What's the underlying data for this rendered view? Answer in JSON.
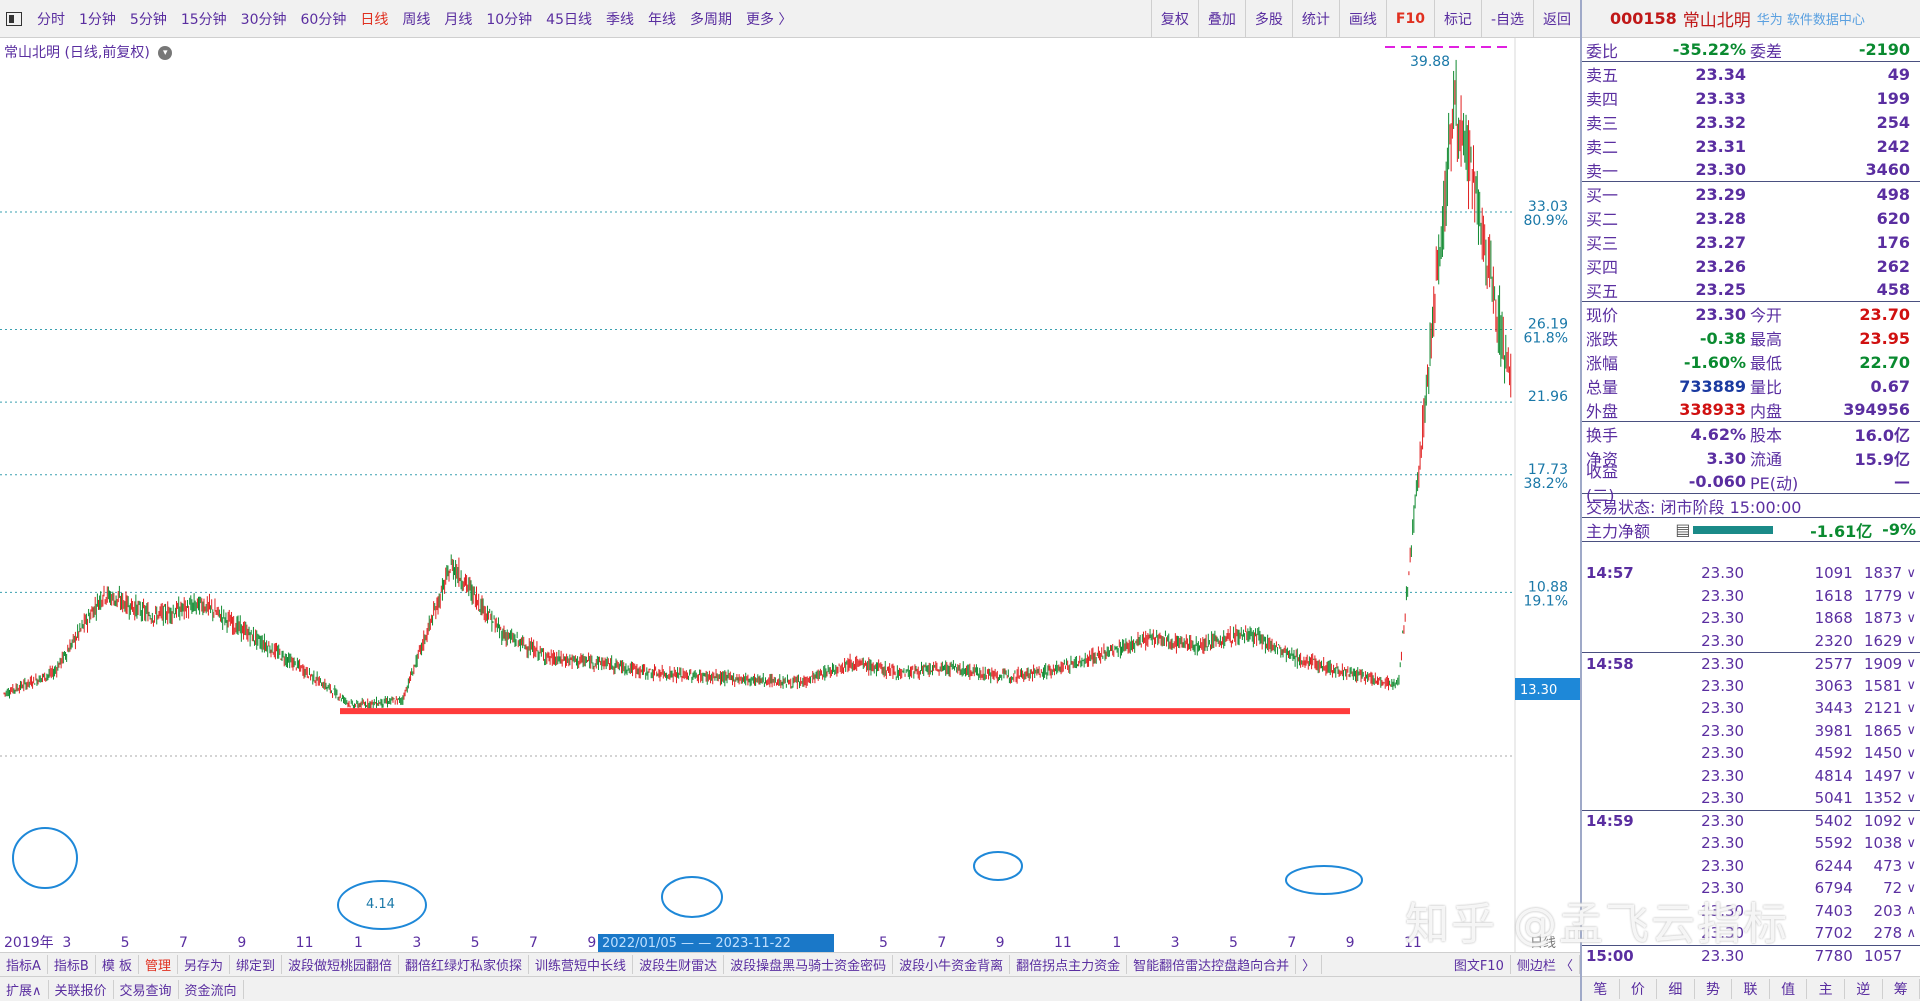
{
  "toolbar": {
    "periods": [
      "分时",
      "1分钟",
      "5分钟",
      "15分钟",
      "30分钟",
      "60分钟",
      "日线",
      "周线",
      "月线",
      "10分钟",
      "45日线",
      "季线",
      "年线",
      "多周期",
      "更多 〉"
    ],
    "tools": [
      "复权",
      "叠加",
      "多股",
      "统计",
      "画线",
      "F10",
      "标记",
      "-自选",
      "返回"
    ]
  },
  "chart": {
    "title": "常山北明 (日线,前复权)",
    "peak_label": "39.88",
    "low_label": "4.14",
    "current_price_label": "13.30",
    "axis_labels": [
      {
        "price": "33.03",
        "pct": "80.9%"
      },
      {
        "price": "26.19",
        "pct": "61.8%"
      },
      {
        "price": "21.96",
        "pct": ""
      },
      {
        "price": "17.73",
        "pct": "38.2%"
      },
      {
        "price": "10.88",
        "pct": "19.1%"
      }
    ],
    "x_labels": [
      "2019年",
      "3",
      "5",
      "7",
      "9",
      "11",
      "1",
      "3",
      "5",
      "7",
      "9",
      "11",
      "2022/01/05",
      "1",
      "3",
      "5",
      "7",
      "9",
      "11",
      "1",
      "3",
      "5",
      "7",
      "9",
      "11"
    ],
    "date_box": "2022/01/05 — — 2023-11-22",
    "side_label": "日线"
  },
  "chart_data": {
    "type": "line",
    "title": "常山北明 (日线,前复权)",
    "x": [
      "2019-01",
      "2019-03",
      "2019-05",
      "2019-07",
      "2019-09",
      "2019-11",
      "2020-01",
      "2020-03",
      "2020-05",
      "2020-07",
      "2020-09",
      "2020-11",
      "2021-01",
      "2021-03",
      "2021-05",
      "2021-07",
      "2021-09",
      "2021-11",
      "2022-01",
      "2022-03",
      "2022-05",
      "2022-07",
      "2022-09",
      "2022-11",
      "2023-01",
      "2023-03",
      "2023-05",
      "2023-07",
      "2023-09",
      "2023-10",
      "2023-11"
    ],
    "series": [
      {
        "values": [
          5.0,
          6.2,
          10.8,
          9.5,
          10.2,
          8.3,
          6.4,
          4.3,
          4.6,
          12.5,
          8.5,
          7.0,
          6.8,
          6.2,
          6.0,
          5.8,
          5.6,
          6.8,
          6.2,
          6.5,
          6.0,
          6.3,
          7.2,
          8.2,
          7.8,
          8.5,
          7.0,
          6.2,
          5.5,
          39.88,
          23.3
        ]
      }
    ],
    "ylim": [
      2.4,
      42.0
    ],
    "support_line": 4.14,
    "reference_levels": [
      33.03,
      26.19,
      21.96,
      17.73,
      10.88
    ]
  },
  "bottom_tabs": [
    "指标A",
    "指标B",
    "模 板",
    "管理",
    "另存为",
    "绑定到",
    "波段做短桃园翻倍",
    "翻倍红绿灯私家侦探",
    "训练营短中长线",
    "波段生财雷达",
    "波段操盘黑马骑士资金密码",
    "波段小牛资金背离",
    "翻倍拐点主力资金",
    "智能翻倍雷达控盘趋向合并",
    "〉"
  ],
  "bottom_tabs_right": [
    "图文F10",
    "侧边栏 〈"
  ],
  "bottom_tabs2": [
    "扩展∧",
    "关联报价",
    "交易查询",
    "资金流向"
  ],
  "panel": {
    "code": "000158",
    "name": "常山北明",
    "extra": "华为 软件数据中心",
    "webi": {
      "label": "委比",
      "value": "-35.22%",
      "label2": "委差",
      "value2": "-2190"
    },
    "asks": [
      {
        "label": "卖五",
        "price": "23.34",
        "vol": "49"
      },
      {
        "label": "卖四",
        "price": "23.33",
        "vol": "199"
      },
      {
        "label": "卖三",
        "price": "23.32",
        "vol": "254"
      },
      {
        "label": "卖二",
        "price": "23.31",
        "vol": "242"
      },
      {
        "label": "卖一",
        "price": "23.30",
        "vol": "3460"
      }
    ],
    "bids": [
      {
        "label": "买一",
        "price": "23.29",
        "vol": "498"
      },
      {
        "label": "买二",
        "price": "23.28",
        "vol": "620"
      },
      {
        "label": "买三",
        "price": "23.27",
        "vol": "176"
      },
      {
        "label": "买四",
        "price": "23.26",
        "vol": "262"
      },
      {
        "label": "买五",
        "price": "23.25",
        "vol": "458"
      }
    ],
    "stats": [
      {
        "l1": "现价",
        "v1": "23.30",
        "l2": "今开",
        "v2": "23.70"
      },
      {
        "l1": "涨跌",
        "v1": "-0.38",
        "l2": "最高",
        "v2": "23.95"
      },
      {
        "l1": "涨幅",
        "v1": "-1.60%",
        "l2": "最低",
        "v2": "22.70"
      },
      {
        "l1": "总量",
        "v1": "733889",
        "l2": "量比",
        "v2": "0.67"
      },
      {
        "l1": "外盘",
        "v1": "338933",
        "l2": "内盘",
        "v2": "394956"
      }
    ],
    "stats2": [
      {
        "l1": "换手",
        "v1": "4.62%",
        "l2": "股本",
        "v2": "16.0亿"
      },
      {
        "l1": "净资",
        "v1": "3.30",
        "l2": "流通",
        "v2": "15.9亿"
      },
      {
        "l1": "收益(二)",
        "v1": "-0.060",
        "l2": "PE(动)",
        "v2": "—"
      }
    ],
    "status": "交易状态: 闭市阶段 15:00:00",
    "main_net": {
      "label": "主力净额",
      "value": "-1.61亿",
      "pct": "-9%"
    },
    "trades": [
      {
        "t": "14:57",
        "p": "23.30",
        "v1": "1091",
        "v2": "1837",
        "d": "∨"
      },
      {
        "t": "",
        "p": "23.30",
        "v1": "1618",
        "v2": "1779",
        "d": "∨"
      },
      {
        "t": "",
        "p": "23.30",
        "v1": "1868",
        "v2": "1873",
        "d": "∨"
      },
      {
        "t": "",
        "p": "23.30",
        "v1": "2320",
        "v2": "1629",
        "d": "∨"
      },
      {
        "t": "14:58",
        "p": "23.30",
        "v1": "2577",
        "v2": "1909",
        "d": "∨"
      },
      {
        "t": "",
        "p": "23.30",
        "v1": "3063",
        "v2": "1581",
        "d": "∨"
      },
      {
        "t": "",
        "p": "23.30",
        "v1": "3443",
        "v2": "2121",
        "d": "∨"
      },
      {
        "t": "",
        "p": "23.30",
        "v1": "3981",
        "v2": "1865",
        "d": "∨"
      },
      {
        "t": "",
        "p": "23.30",
        "v1": "4592",
        "v2": "1450",
        "d": "∨"
      },
      {
        "t": "",
        "p": "23.30",
        "v1": "4814",
        "v2": "1497",
        "d": "∨"
      },
      {
        "t": "",
        "p": "23.30",
        "v1": "5041",
        "v2": "1352",
        "d": "∨"
      },
      {
        "t": "14:59",
        "p": "23.30",
        "v1": "5402",
        "v2": "1092",
        "d": "∨"
      },
      {
        "t": "",
        "p": "23.30",
        "v1": "5592",
        "v2": "1038",
        "d": "∨"
      },
      {
        "t": "",
        "p": "23.30",
        "v1": "6244",
        "v2": "473",
        "d": "∨"
      },
      {
        "t": "",
        "p": "23.30",
        "v1": "6794",
        "v2": "72",
        "d": "∨"
      },
      {
        "t": "",
        "p": "23.30",
        "v1": "7403",
        "v2": "203",
        "d": "∧"
      },
      {
        "t": "",
        "p": "23.30",
        "v1": "7702",
        "v2": "278",
        "d": "∧"
      },
      {
        "t": "15:00",
        "p": "23.30",
        "v1": "7780",
        "v2": "1057",
        "d": ""
      }
    ],
    "bottom_tabs": [
      "笔",
      "价",
      "细",
      "势",
      "联",
      "值",
      "主",
      "逆",
      "筹"
    ]
  },
  "watermark": "知乎 @孟飞云指标",
  "colors": {
    "up": "#e02020",
    "down": "#108a30",
    "support": "#ff3b3b",
    "circle": "#1e88d8",
    "grid": "#3aa0b0",
    "accent": "#5a2ea0"
  }
}
